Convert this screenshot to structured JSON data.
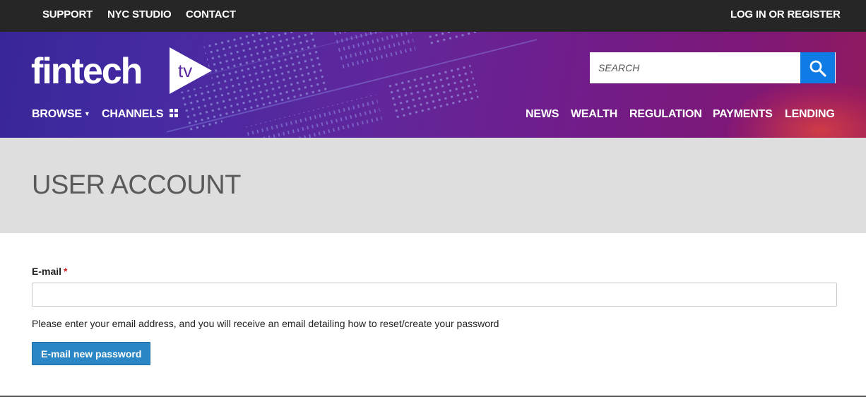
{
  "topbar": {
    "links": [
      "SUPPORT",
      "NYC STUDIO",
      "CONTACT"
    ],
    "login": "LOG IN OR REGISTER"
  },
  "header": {
    "logo_text": "fintech",
    "logo_mark_text": "tv",
    "search": {
      "placeholder": "SEARCH",
      "value": ""
    },
    "nav_left": {
      "browse": "BROWSE",
      "channels": "CHANNELS"
    },
    "nav_right": [
      "NEWS",
      "WEALTH",
      "REGULATION",
      "PAYMENTS",
      "LENDING"
    ]
  },
  "page": {
    "title": "USER ACCOUNT"
  },
  "form": {
    "email_label": "E-mail",
    "required_mark": "*",
    "email_value": "",
    "help_text": "Please enter your email address, and you will receive an email detailing how to reset/create your password",
    "submit_label": "E-mail new password"
  },
  "icons": {
    "search": "search-icon",
    "browse_caret": "caret-down-icon",
    "channels_grid": "grid-icon",
    "logo_play": "play-icon"
  },
  "colors": {
    "topbar": "#262626",
    "search_button": "#0f7ce6",
    "submit_button": "#2a86c4",
    "title_band": "#dedede",
    "required": "#cc1f1f"
  }
}
